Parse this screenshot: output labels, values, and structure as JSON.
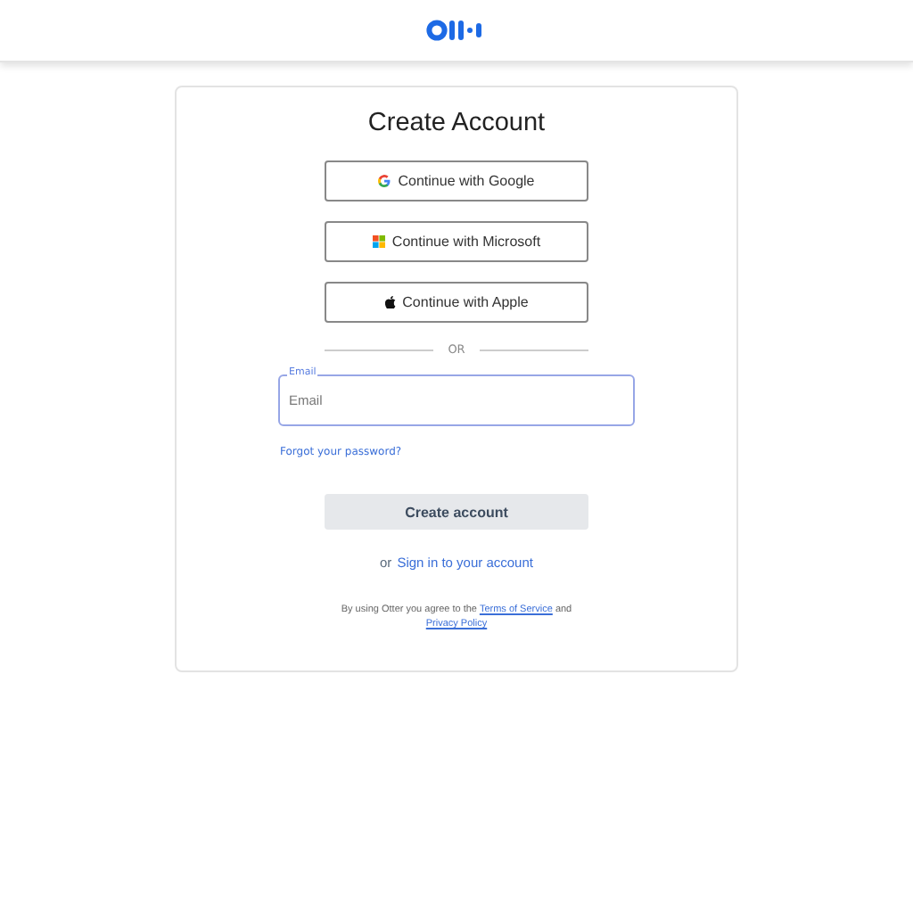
{
  "title": "Create Account",
  "providers": [
    {
      "kind": "google",
      "label": "Continue with Google"
    },
    {
      "kind": "microsoft",
      "label": "Continue with Microsoft"
    },
    {
      "kind": "apple",
      "label": "Continue with Apple"
    }
  ],
  "divider": "OR",
  "email": {
    "label": "Email",
    "placeholder": "Email"
  },
  "forgot": "Forgot your password?",
  "submit": {
    "label": "Create account",
    "disabled": true
  },
  "signin": {
    "prefix": "or",
    "link": "Sign in to your account"
  },
  "terms": {
    "before": "By using Otter you agree to the",
    "terms_link": "Terms of Service",
    "middle": "and",
    "privacy_link": "Privacy Policy"
  }
}
